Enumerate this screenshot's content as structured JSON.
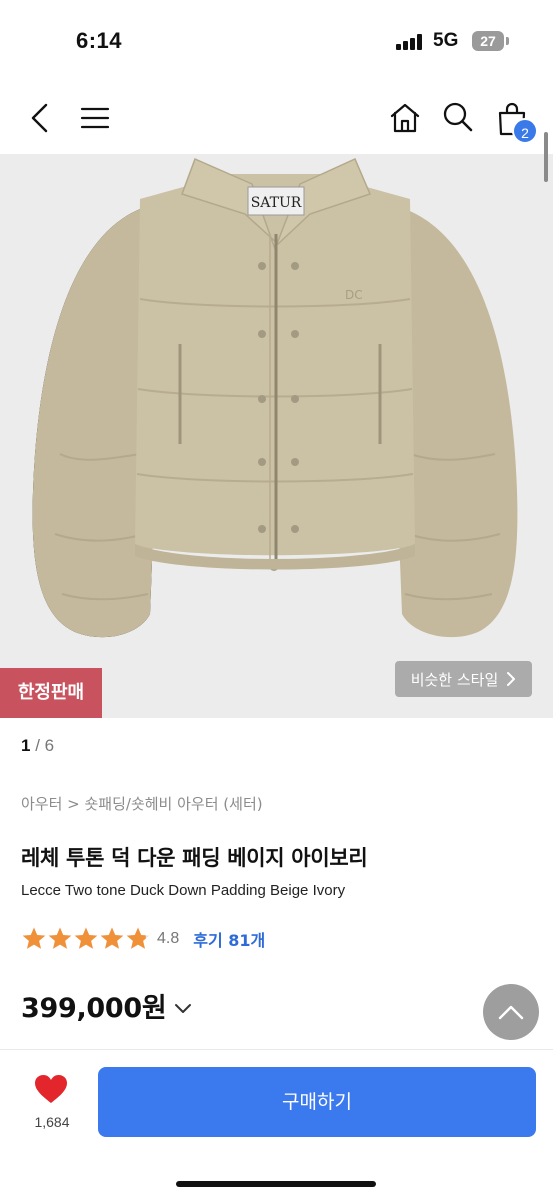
{
  "status_bar": {
    "time": "6:14",
    "network": "5G",
    "battery": "27"
  },
  "header": {
    "icons": [
      "back-icon",
      "menu-icon",
      "home-icon",
      "search-icon",
      "cart-icon"
    ],
    "cart_badge": "2"
  },
  "gallery": {
    "current_page": "1",
    "page_separator": " / ",
    "total_pages": "6",
    "limited_badge": "한정판매",
    "similar_style_button": "비슷한 스타일",
    "brand_label": "SATUR",
    "background_color": "#ececec",
    "jacket_color": "#c7bc9f"
  },
  "product": {
    "breadcrumb": "아우터 > 숏패딩/숏헤비 아우터 (세터)",
    "title_ko": "레체 투톤 덕 다운 패딩 베이지 아이보리",
    "title_en": "Lecce Two tone Duck Down Padding Beige Ivory",
    "rating": "4.8",
    "rating_stars": 4.8,
    "rating_max": 5,
    "reviews_label": "후기 81개",
    "price": "399,000원"
  },
  "bottom_bar": {
    "like_count": "1,684",
    "buy_button": "구매하기",
    "accent_color": "#3a79ee",
    "like_color": "#e3262c"
  }
}
